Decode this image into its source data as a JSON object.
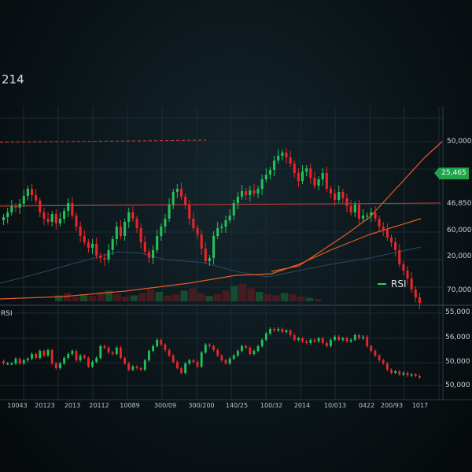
{
  "top_left_label": "214",
  "current_price": "25,465",
  "chart_data": {
    "type": "candlestick",
    "legend": {
      "entries": [
        "RSI"
      ],
      "swatch_color": "#2fd35a",
      "placement": "bottom-right"
    },
    "price_axis_labels": [
      "50,000",
      "46,850",
      "60,000",
      "20,000",
      "70,000"
    ],
    "rsi_panel_label": "RSI",
    "rsi_axis_labels": [
      "55,000",
      "56,000",
      "50,000",
      "50,000"
    ],
    "x_tick_labels": [
      "10043",
      "20123",
      "2013",
      "20112",
      "10089",
      "300/09",
      "300/200",
      "140/25",
      "100/32",
      "2014",
      "10/013",
      "0422",
      "200/93",
      "1017"
    ],
    "colors": {
      "up": "#23c15a",
      "down": "#e8262a",
      "trend_line": "#e0392f",
      "ma_orange": "#e85a24",
      "ma_blue": "#2a4a66",
      "grid": "#1b2c33"
    },
    "grid": true,
    "main_closes": [
      264,
      270,
      278,
      276,
      281,
      291,
      300,
      292,
      285,
      270,
      262,
      258,
      268,
      256,
      262,
      272,
      282,
      266,
      252,
      240,
      232,
      225,
      230,
      215,
      212,
      210,
      222,
      236,
      252,
      240,
      258,
      270,
      262,
      250,
      232,
      220,
      212,
      222,
      240,
      252,
      262,
      280,
      296,
      300,
      290,
      280,
      262,
      250,
      242,
      224,
      208,
      212,
      240,
      250,
      252,
      260,
      266,
      282,
      290,
      297,
      292,
      298,
      294,
      300,
      312,
      318,
      324,
      336,
      342,
      346,
      340,
      332,
      320,
      310,
      322,
      326,
      314,
      304,
      312,
      320,
      300,
      294,
      286,
      296,
      288,
      278,
      270,
      280,
      262,
      266,
      266,
      270,
      262,
      252,
      248,
      238,
      232,
      222,
      204,
      196,
      186,
      172,
      162,
      155
    ],
    "volume": [
      10,
      14,
      8,
      12,
      9,
      16,
      18,
      12,
      8,
      10,
      14,
      20,
      16,
      10,
      12,
      18,
      22,
      14,
      9,
      12,
      18,
      26,
      30,
      22,
      16,
      12,
      10,
      14,
      12,
      8,
      6,
      4
    ],
    "rsi_values": [
      462,
      462,
      462,
      456,
      462,
      458,
      456,
      450,
      455,
      446,
      452,
      445,
      462,
      468,
      462,
      455,
      450,
      446,
      458,
      452,
      455,
      466,
      460,
      455,
      440,
      442,
      448,
      450,
      442,
      455,
      462,
      470,
      466,
      468,
      470,
      458,
      446,
      440,
      432,
      438,
      445,
      452,
      460,
      468,
      474,
      462,
      458,
      460,
      466,
      448,
      438,
      440,
      445,
      452,
      458,
      462,
      456,
      452,
      446,
      440,
      442,
      450,
      446,
      440,
      432,
      424,
      418,
      420,
      418,
      422,
      420,
      426,
      432,
      430,
      434,
      436,
      432,
      434,
      430,
      436,
      440,
      432,
      428,
      432,
      430,
      434,
      432,
      426,
      430,
      428,
      440,
      446,
      452,
      458,
      462,
      470,
      474,
      472,
      476,
      474,
      477,
      476,
      478,
      480
    ]
  }
}
